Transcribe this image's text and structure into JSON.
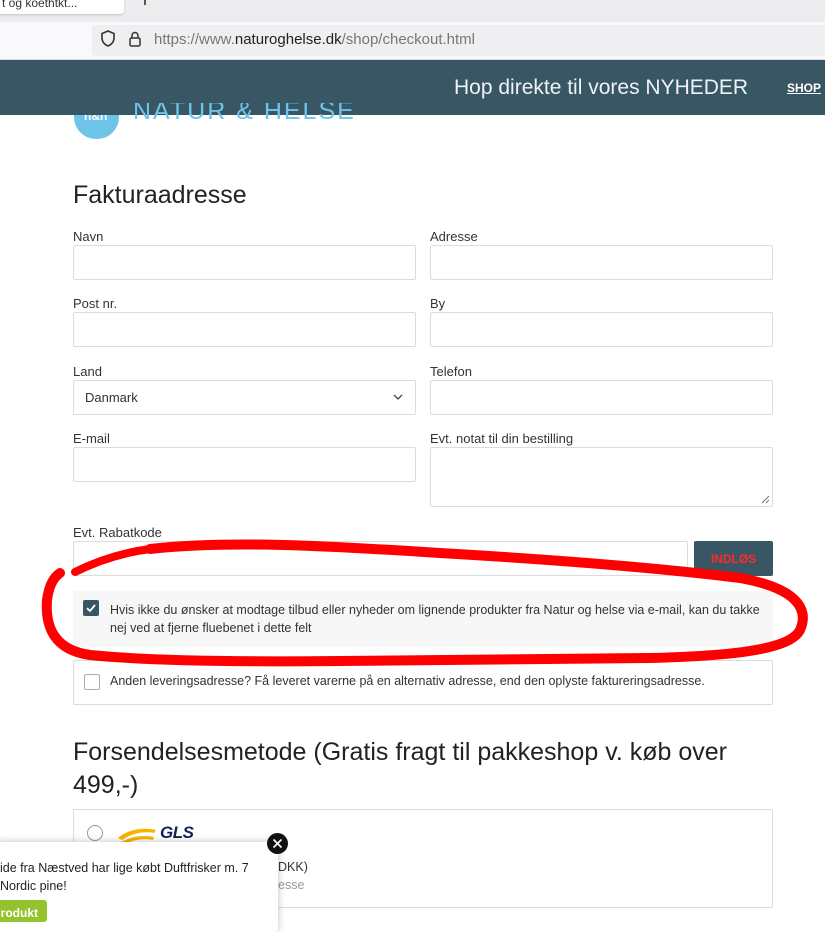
{
  "browser": {
    "tab_title": "t og koethtkt...",
    "url": {
      "prefix": "https://www.",
      "host": "naturoghelse.dk",
      "path": "/shop/checkout.html"
    }
  },
  "site": {
    "promo_text": "Hop direkte til vores NYHEDER",
    "shop_link": "SHOP",
    "logo_badge": "n&h",
    "logo_text": "NATUR & HELSE",
    "brand_color": "#385663",
    "accent_color": "#6ec4e8"
  },
  "billing": {
    "title": "Fakturaadresse",
    "name_label": "Navn",
    "address_label": "Adresse",
    "zip_label": "Post nr.",
    "city_label": "By",
    "country_label": "Land",
    "country_value": "Danmark",
    "phone_label": "Telefon",
    "email_label": "E-mail",
    "notes_label": "Evt. notat til din bestilling",
    "discount_label": "Evt. Rabatkode",
    "apply_button": "INDLØS",
    "newsletter_text": "Hvis ikke du ønsker at modtage tilbud eller nyheder om lignende produkter fra Natur og helse via e-mail, kan du takke nej ved at fjerne fluebenet i dette felt",
    "newsletter_checked": true,
    "alt_delivery_text": "Anden leveringsadresse? Få leveret varerne på en alternativ adresse, end den oplyste faktureringsadresse.",
    "alt_delivery_checked": false
  },
  "shipping": {
    "title": "Forsendelsesmetode (Gratis fragt til pakkeshop v. køb over 499,-)",
    "carrier_logo": "GLS",
    "price_partial": "DKK)",
    "sub_partial": "esse"
  },
  "popup": {
    "text": "ide fra Næstved har lige købt Duftfrisker m. 7 Nordic pine!",
    "button": "rodukt"
  },
  "annotation": {
    "marker_color": "#ff0000"
  }
}
